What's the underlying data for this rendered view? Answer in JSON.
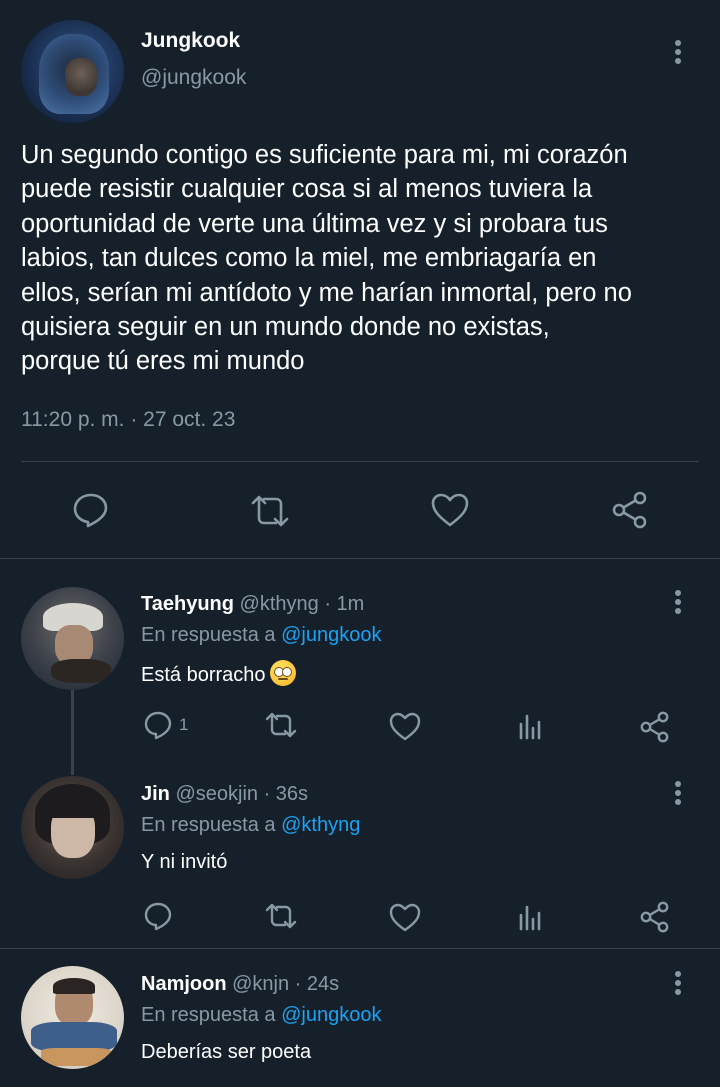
{
  "main_tweet": {
    "author_name": "Jungkook",
    "author_handle": "@jungkook",
    "text_lines": [
      "Un segundo contigo es suficiente para mi, mi corazón",
      "puede resistir cualquier cosa si al menos tuviera la",
      "oportunidad de verte una última vez y si probara tus",
      "labios, tan dulces como la miel, me embriagaría en",
      "ellos, serían mi antídoto y me harían inmortal, pero no",
      "quisiera seguir en un mundo donde no existas,",
      "porque tú eres mi mundo"
    ],
    "timestamp": "11:20 p. m. · 27 oct. 23",
    "actions": [
      "reply-icon",
      "retweet-icon",
      "like-icon",
      "share-icon"
    ]
  },
  "replies": [
    {
      "name": "Taehyung",
      "handle": "@kthyng",
      "time": "· 1m",
      "reply_prefix": "En respuesta a ",
      "reply_to": "@jungkook",
      "text": "Está borracho",
      "emoji": "face-with-rolling-eyes",
      "reply_count": "1"
    },
    {
      "name": "Jin",
      "handle": "@seokjin",
      "time": "· 36s",
      "reply_prefix": "En respuesta a ",
      "reply_to": "@kthyng",
      "text": "Y ni invitó"
    },
    {
      "name": "Namjoon",
      "handle": "@knjn",
      "time": "· 24s",
      "reply_prefix": "En respuesta a ",
      "reply_to": "@jungkook",
      "text": "Deberías ser poeta"
    }
  ],
  "colors": {
    "background": "#15202b",
    "text": "#ffffff",
    "muted": "#8899a6",
    "link": "#1da1f2",
    "border": "#38444d"
  }
}
